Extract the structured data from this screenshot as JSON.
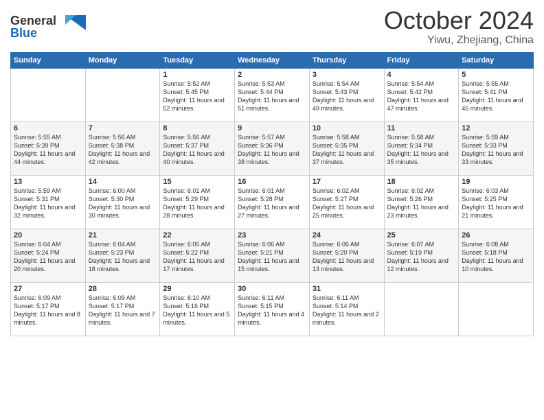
{
  "header": {
    "logo": "GeneralBlue",
    "month": "October 2024",
    "location": "Yiwu, Zhejiang, China"
  },
  "weekdays": [
    "Sunday",
    "Monday",
    "Tuesday",
    "Wednesday",
    "Thursday",
    "Friday",
    "Saturday"
  ],
  "weeks": [
    [
      {
        "day": "",
        "info": ""
      },
      {
        "day": "",
        "info": ""
      },
      {
        "day": "1",
        "info": "Sunrise: 5:52 AM\nSunset: 5:45 PM\nDaylight: 11 hours and 52 minutes."
      },
      {
        "day": "2",
        "info": "Sunrise: 5:53 AM\nSunset: 5:44 PM\nDaylight: 11 hours and 51 minutes."
      },
      {
        "day": "3",
        "info": "Sunrise: 5:54 AM\nSunset: 5:43 PM\nDaylight: 11 hours and 49 minutes."
      },
      {
        "day": "4",
        "info": "Sunrise: 5:54 AM\nSunset: 5:42 PM\nDaylight: 11 hours and 47 minutes."
      },
      {
        "day": "5",
        "info": "Sunrise: 5:55 AM\nSunset: 5:41 PM\nDaylight: 11 hours and 45 minutes."
      }
    ],
    [
      {
        "day": "6",
        "info": "Sunrise: 5:55 AM\nSunset: 5:39 PM\nDaylight: 11 hours and 44 minutes."
      },
      {
        "day": "7",
        "info": "Sunrise: 5:56 AM\nSunset: 5:38 PM\nDaylight: 11 hours and 42 minutes."
      },
      {
        "day": "8",
        "info": "Sunrise: 5:56 AM\nSunset: 5:37 PM\nDaylight: 11 hours and 40 minutes."
      },
      {
        "day": "9",
        "info": "Sunrise: 5:57 AM\nSunset: 5:36 PM\nDaylight: 11 hours and 38 minutes."
      },
      {
        "day": "10",
        "info": "Sunrise: 5:58 AM\nSunset: 5:35 PM\nDaylight: 11 hours and 37 minutes."
      },
      {
        "day": "11",
        "info": "Sunrise: 5:58 AM\nSunset: 5:34 PM\nDaylight: 11 hours and 35 minutes."
      },
      {
        "day": "12",
        "info": "Sunrise: 5:59 AM\nSunset: 5:33 PM\nDaylight: 11 hours and 33 minutes."
      }
    ],
    [
      {
        "day": "13",
        "info": "Sunrise: 5:59 AM\nSunset: 5:31 PM\nDaylight: 11 hours and 32 minutes."
      },
      {
        "day": "14",
        "info": "Sunrise: 6:00 AM\nSunset: 5:30 PM\nDaylight: 11 hours and 30 minutes."
      },
      {
        "day": "15",
        "info": "Sunrise: 6:01 AM\nSunset: 5:29 PM\nDaylight: 11 hours and 28 minutes."
      },
      {
        "day": "16",
        "info": "Sunrise: 6:01 AM\nSunset: 5:28 PM\nDaylight: 11 hours and 27 minutes."
      },
      {
        "day": "17",
        "info": "Sunrise: 6:02 AM\nSunset: 5:27 PM\nDaylight: 11 hours and 25 minutes."
      },
      {
        "day": "18",
        "info": "Sunrise: 6:02 AM\nSunset: 5:26 PM\nDaylight: 11 hours and 23 minutes."
      },
      {
        "day": "19",
        "info": "Sunrise: 6:03 AM\nSunset: 5:25 PM\nDaylight: 11 hours and 21 minutes."
      }
    ],
    [
      {
        "day": "20",
        "info": "Sunrise: 6:04 AM\nSunset: 5:24 PM\nDaylight: 11 hours and 20 minutes."
      },
      {
        "day": "21",
        "info": "Sunrise: 6:04 AM\nSunset: 5:23 PM\nDaylight: 11 hours and 18 minutes."
      },
      {
        "day": "22",
        "info": "Sunrise: 6:05 AM\nSunset: 5:22 PM\nDaylight: 11 hours and 17 minutes."
      },
      {
        "day": "23",
        "info": "Sunrise: 6:06 AM\nSunset: 5:21 PM\nDaylight: 11 hours and 15 minutes."
      },
      {
        "day": "24",
        "info": "Sunrise: 6:06 AM\nSunset: 5:20 PM\nDaylight: 11 hours and 13 minutes."
      },
      {
        "day": "25",
        "info": "Sunrise: 6:07 AM\nSunset: 5:19 PM\nDaylight: 11 hours and 12 minutes."
      },
      {
        "day": "26",
        "info": "Sunrise: 6:08 AM\nSunset: 5:18 PM\nDaylight: 11 hours and 10 minutes."
      }
    ],
    [
      {
        "day": "27",
        "info": "Sunrise: 6:09 AM\nSunset: 5:17 PM\nDaylight: 11 hours and 8 minutes."
      },
      {
        "day": "28",
        "info": "Sunrise: 6:09 AM\nSunset: 5:17 PM\nDaylight: 11 hours and 7 minutes."
      },
      {
        "day": "29",
        "info": "Sunrise: 6:10 AM\nSunset: 5:16 PM\nDaylight: 11 hours and 5 minutes."
      },
      {
        "day": "30",
        "info": "Sunrise: 6:11 AM\nSunset: 5:15 PM\nDaylight: 11 hours and 4 minutes."
      },
      {
        "day": "31",
        "info": "Sunrise: 6:11 AM\nSunset: 5:14 PM\nDaylight: 11 hours and 2 minutes."
      },
      {
        "day": "",
        "info": ""
      },
      {
        "day": "",
        "info": ""
      }
    ]
  ]
}
